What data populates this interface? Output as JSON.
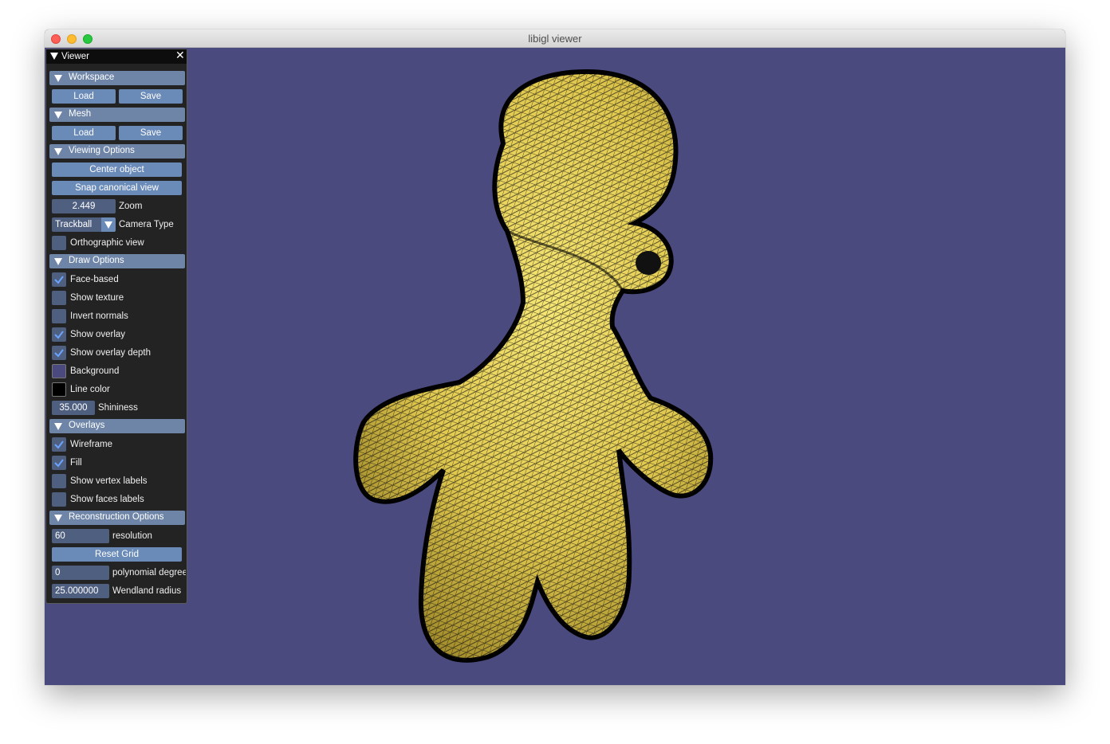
{
  "window": {
    "title": "libigl viewer"
  },
  "panel": {
    "title": "Viewer",
    "workspace": {
      "header": "Workspace",
      "load": "Load",
      "save": "Save"
    },
    "mesh": {
      "header": "Mesh",
      "load": "Load",
      "save": "Save"
    },
    "viewing": {
      "header": "Viewing Options",
      "center_object": "Center object",
      "snap_view": "Snap canonical view",
      "zoom_value": "2.449",
      "zoom_label": "Zoom",
      "camera_type_value": "Trackball",
      "camera_type_label": "Camera Type",
      "orthographic_label": "Orthographic view",
      "orthographic_checked": false
    },
    "draw": {
      "header": "Draw Options",
      "face_based": "Face-based",
      "show_texture": "Show texture",
      "invert_normals": "Invert normals",
      "show_overlay": "Show overlay",
      "show_overlay_depth": "Show overlay depth",
      "background": "Background",
      "background_color": "#4b4a7f",
      "line_color": "Line color",
      "line_color_value": "#000000",
      "shininess_value": "35.000",
      "shininess_label": "Shininess"
    },
    "overlays": {
      "header": "Overlays",
      "wireframe": "Wireframe",
      "fill": "Fill",
      "vertex_labels": "Show vertex labels",
      "faces_labels": "Show faces labels"
    },
    "reconstruction": {
      "header": "Reconstruction Options",
      "resolution_value": "60",
      "resolution_label": "resolution",
      "reset_grid": "Reset Grid",
      "poly_degree_value": "0",
      "poly_degree_label": "polynomial degree",
      "wendland_value": "25.000000",
      "wendland_label": "Wendland radius"
    }
  },
  "colors": {
    "viewport_background": "#4b4a7f",
    "mesh_fill": "#e8d35a",
    "mesh_wire": "#000000",
    "accent_button": "#6a8ab8",
    "header": "#6e85a8"
  }
}
